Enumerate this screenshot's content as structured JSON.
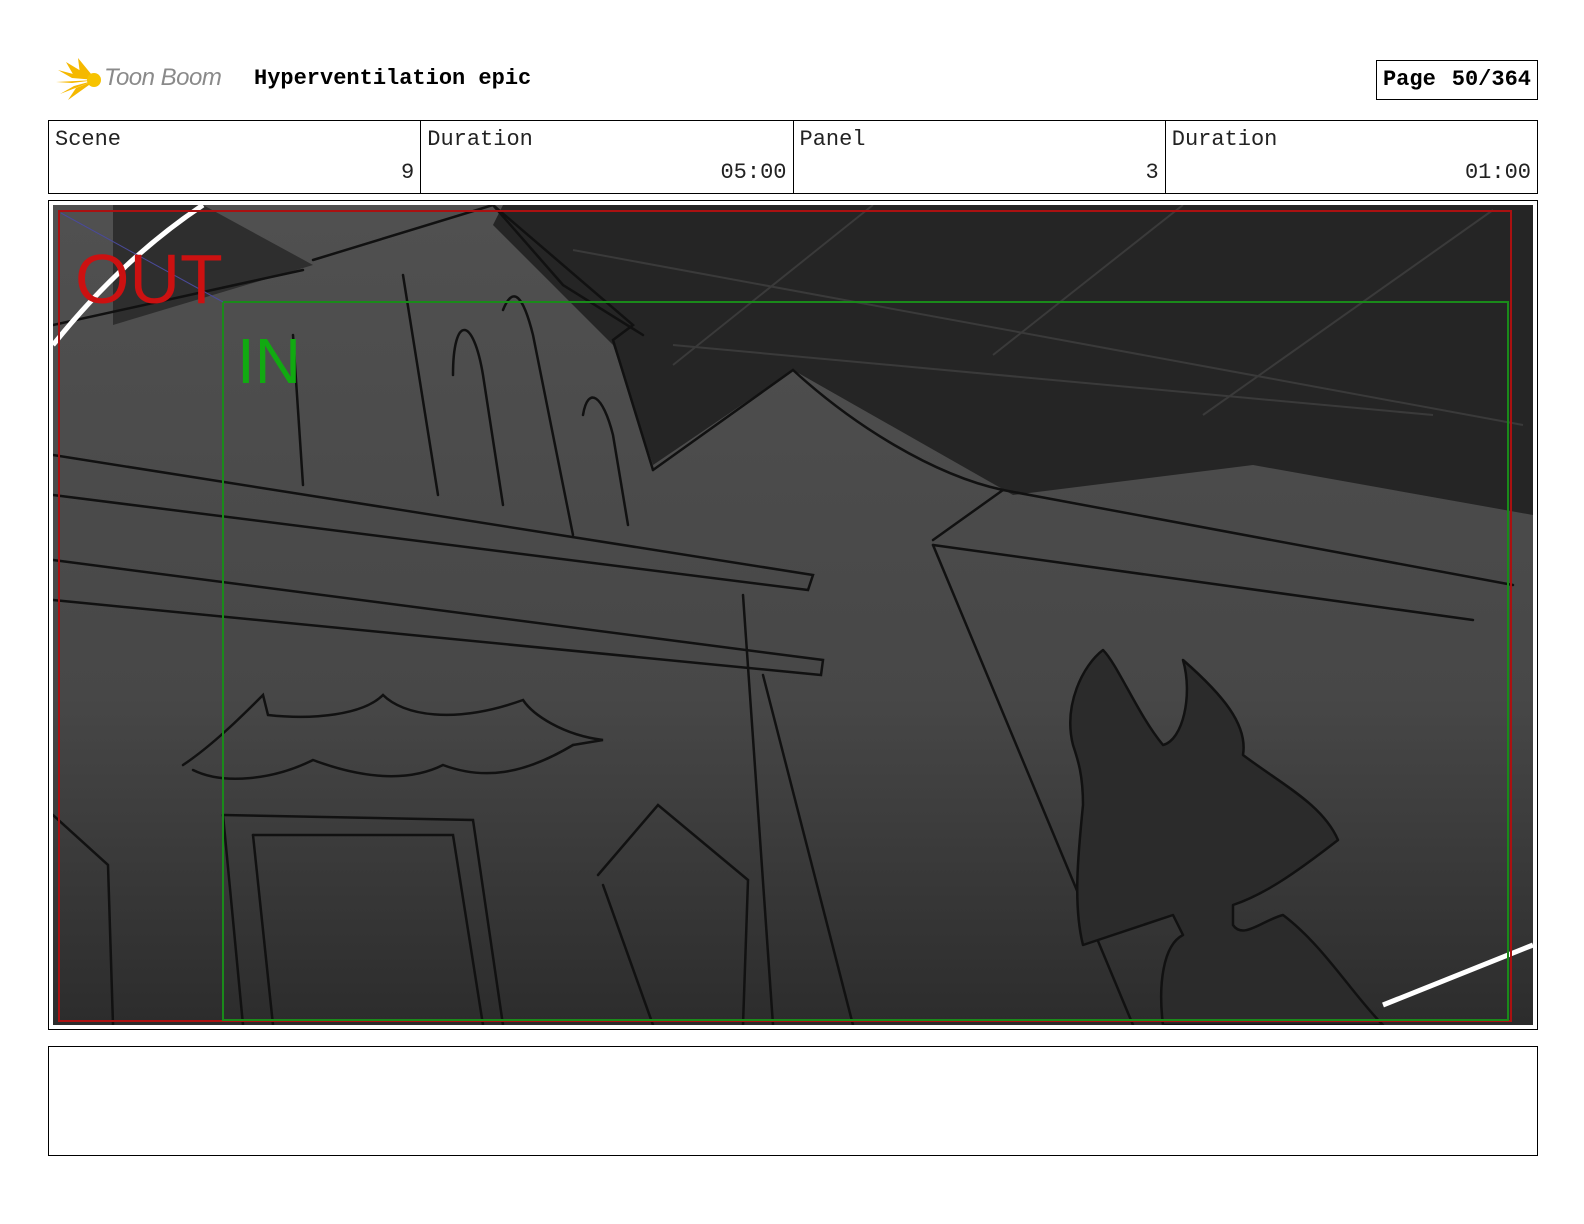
{
  "header": {
    "logo_text": "Toon Boom",
    "project_title": "Hyperventilation epic",
    "page_label": "Page",
    "page_number": "50/364"
  },
  "info": {
    "scene_label": "Scene",
    "scene_value": "9",
    "scene_duration_label": "Duration",
    "scene_duration_value": "05:00",
    "panel_label": "Panel",
    "panel_value": "3",
    "panel_duration_label": "Duration",
    "panel_duration_value": "01:00"
  },
  "panel": {
    "out_label": "OUT",
    "in_label": "IN",
    "out_color": "#cc1111",
    "in_color": "#11aa11"
  },
  "notes": {
    "text": ""
  },
  "colors": {
    "logo_accent": "#f5b800",
    "panel_background": "#4a4a4a",
    "panel_shadow": "#2a2a2a"
  }
}
